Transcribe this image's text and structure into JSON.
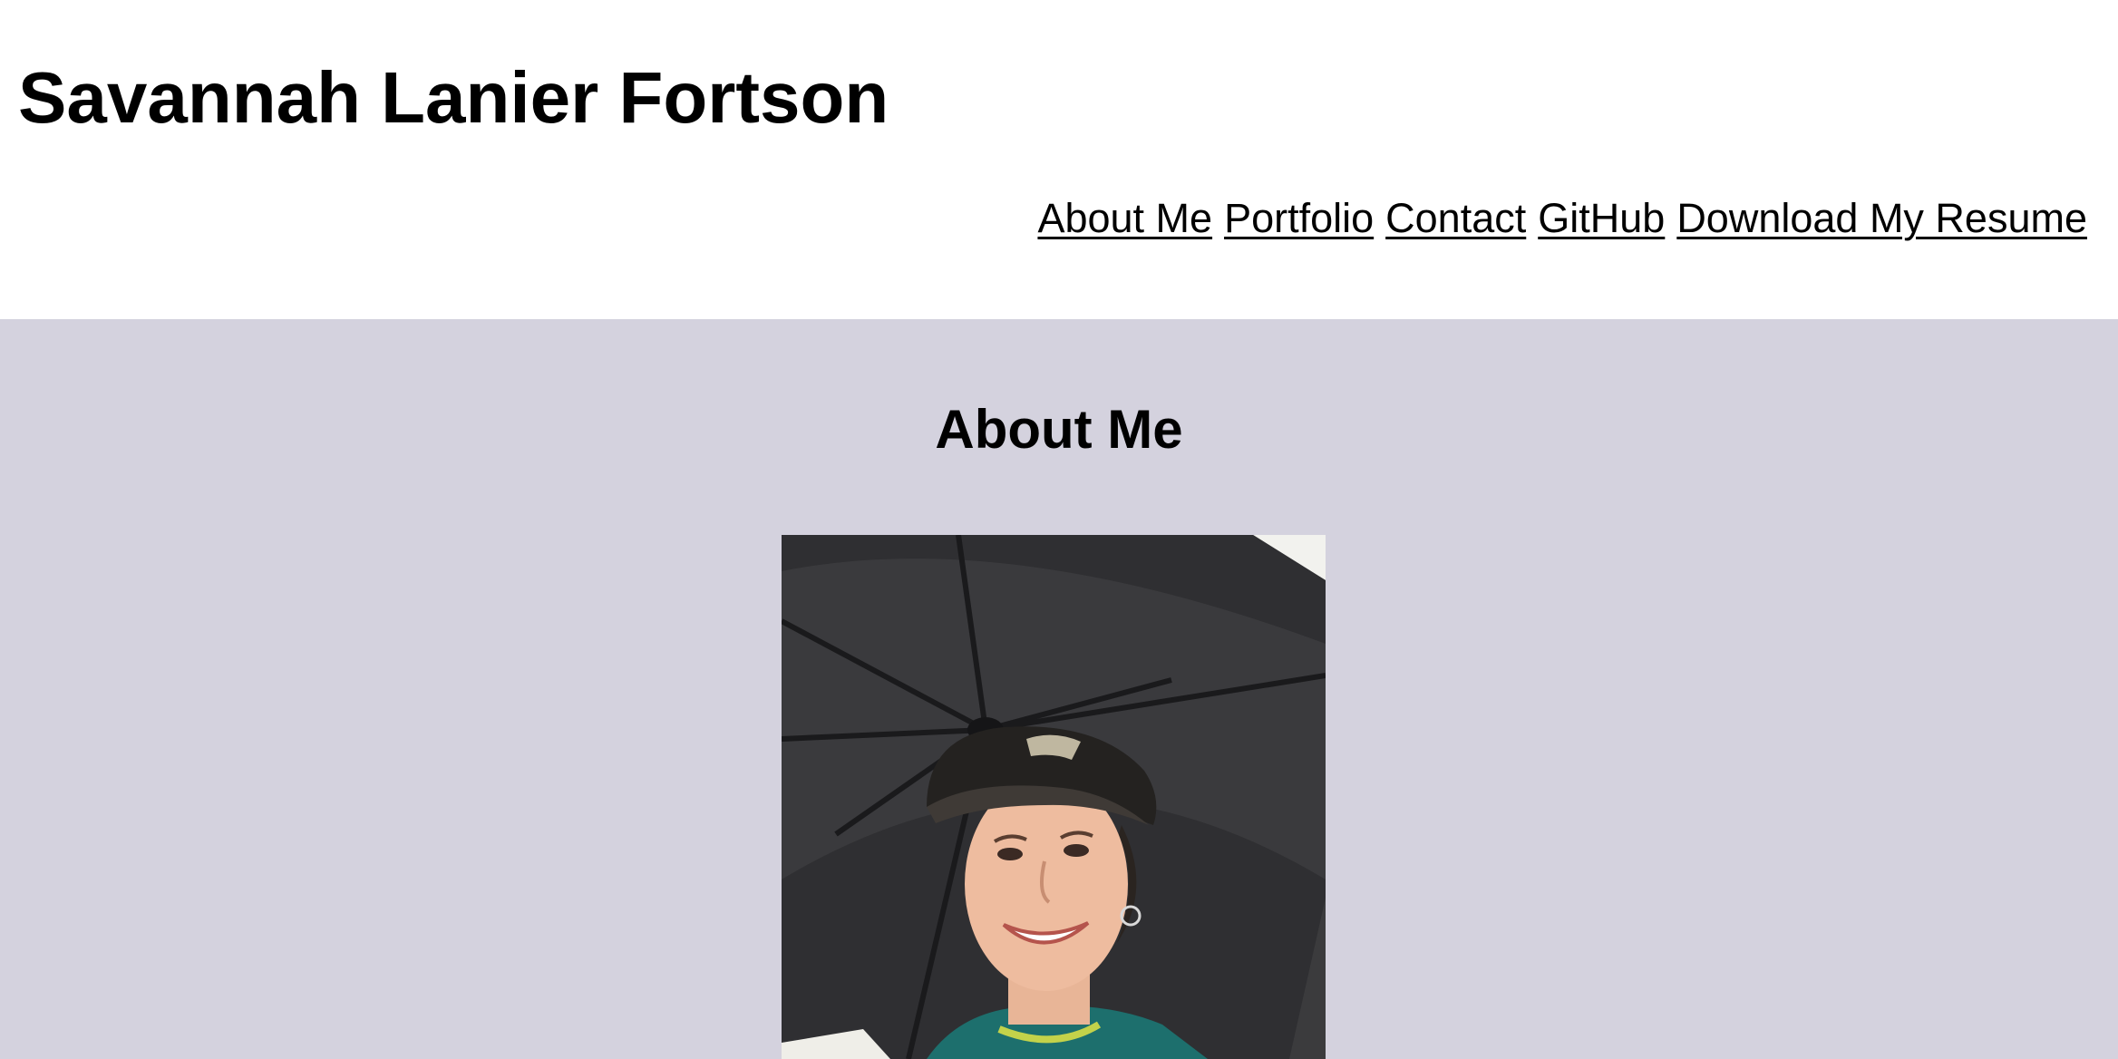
{
  "header": {
    "site_title": "Savannah Lanier Fortson"
  },
  "nav": {
    "items": [
      {
        "label": "About Me"
      },
      {
        "label": "Portfolio"
      },
      {
        "label": "Contact"
      },
      {
        "label": "GitHub"
      },
      {
        "label": "Download My Resume"
      }
    ]
  },
  "about": {
    "title": "About Me",
    "photo_icon": "portrait-photo"
  },
  "colors": {
    "header_bg": "#ffffff",
    "section_bg": "#d4d2de",
    "text": "#000000"
  }
}
